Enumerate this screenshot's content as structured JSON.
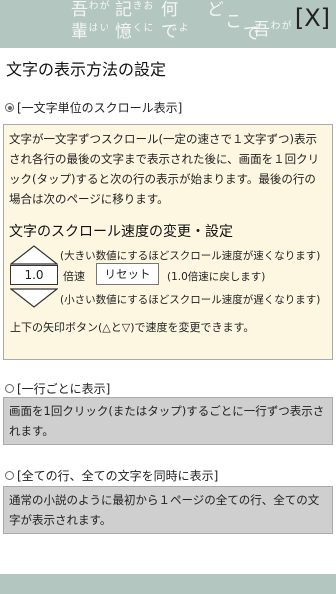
{
  "header": {
    "close_label": "[X]",
    "deco_left": [
      "吾",
      "わ",
      "が",
      "輩",
      "は",
      "い"
    ],
    "deco_mid1": [
      "記",
      "き",
      "お",
      "く",
      "憶",
      "に"
    ],
    "deco_mid2": [
      "何",
      "で",
      "よ"
    ],
    "deco_mid3": [
      "ど",
      "こ",
      "で"
    ],
    "deco_right": [
      "吾",
      "わ",
      "が",
      "輩"
    ]
  },
  "page_title": "文字の表示方法の設定",
  "options": [
    {
      "label": "[一文字単位のスクロール表示]",
      "selected": true,
      "description": "文字が一文字ずつスクロール(一定の速さで１文字ずつ)表示され各行の最後の文字まで表示された後に、画面を１回クリック(タップ)すると次の行の表示が始まります。最後の行の場合は次のページに移ります。",
      "speed_section": {
        "heading": "文字のスクロール速度の変更・設定",
        "up_hint": "(大きい数値にするほどスクロール速度が速くなります)",
        "speed_value": "1.0",
        "speed_unit": "倍速",
        "reset_label": "リセット",
        "reset_hint": "(1.0倍速に戻します)",
        "down_hint": "(小さい数値にするほどスクロール速度が遅くなります)",
        "note": "上下の矢印ボタン(△と▽)で速度を変更できます。"
      }
    },
    {
      "label": "[一行ごとに表示]",
      "selected": false,
      "description": "画面を1回クリック(またはタップ)するごとに一行ずつ表示されます。"
    },
    {
      "label": "[全ての行、全ての文字を同時に表示]",
      "selected": false,
      "description": "通常の小説のように最初から１ページの全ての行、全ての文字が表示されます。"
    }
  ]
}
